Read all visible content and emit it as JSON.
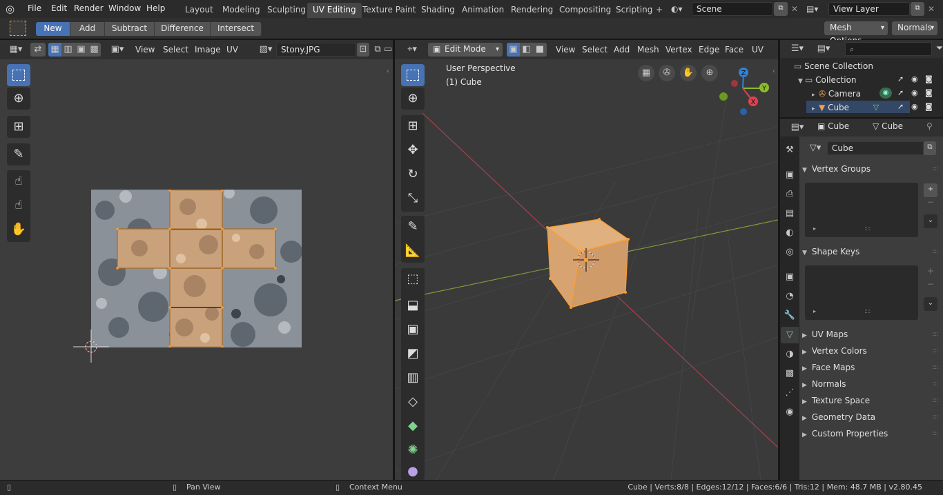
{
  "topbar": {
    "menus": [
      "File",
      "Edit",
      "Render",
      "Window",
      "Help"
    ],
    "workspaces": [
      "Layout",
      "Modeling",
      "Sculpting",
      "UV Editing",
      "Texture Paint",
      "Shading",
      "Animation",
      "Rendering",
      "Compositing",
      "Scripting"
    ],
    "active_workspace": "UV Editing",
    "add_tab": "+",
    "scene": "Scene",
    "view_layer": "View Layer"
  },
  "toolheader": {
    "modes": [
      "New",
      "Add",
      "Subtract",
      "Difference",
      "Intersect"
    ],
    "mesh_options": "Mesh Options",
    "orientation": "Normals"
  },
  "uv_editor": {
    "menus": [
      "View",
      "Select",
      "Image",
      "UV"
    ],
    "image_name": "Stony.JPG"
  },
  "viewport": {
    "mode": "Edit Mode",
    "menus": [
      "View",
      "Select",
      "Add",
      "Mesh",
      "Vertex",
      "Edge",
      "Face",
      "UV"
    ],
    "overlay_title": "User Perspective",
    "overlay_object": "(1) Cube",
    "axis": {
      "z": "Z",
      "y": "Y",
      "x": "X"
    },
    "colors": {
      "x": "#e2414f",
      "y": "#8bbc2c",
      "z": "#2f82da"
    }
  },
  "outliner": {
    "items": [
      {
        "label": "Scene Collection"
      },
      {
        "label": "Collection"
      },
      {
        "label": "Camera"
      },
      {
        "label": "Cube"
      }
    ]
  },
  "properties": {
    "object_name": "Cube",
    "mesh_name": "Cube",
    "data_field": "Cube",
    "panels_open": [
      {
        "label": "Vertex Groups"
      },
      {
        "label": "Shape Keys"
      }
    ],
    "panels_closed": [
      "UV Maps",
      "Vertex Colors",
      "Face Maps",
      "Normals",
      "Texture Space",
      "Geometry Data",
      "Custom Properties"
    ]
  },
  "statusbar": {
    "left": "Pan View",
    "mid": "Context Menu",
    "stats": "Cube | Verts:8/8 | Edges:12/12 | Faces:6/6 | Tris:12 | Mem: 48.7 MB | v2.80.45"
  },
  "accent": "#4772b3",
  "selection": "#ff9d2e"
}
